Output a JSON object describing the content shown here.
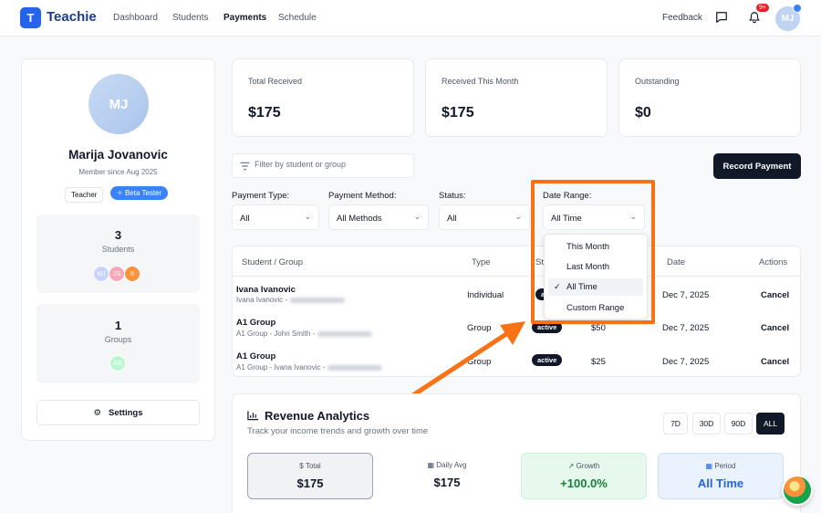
{
  "app": {
    "logo_letter": "T",
    "name": "Teachie"
  },
  "nav": {
    "links": [
      "Dashboard",
      "Students",
      "Payments",
      "Schedule"
    ],
    "active": "Payments",
    "feedback": "Feedback",
    "notif_badge": "9+",
    "user_initials": "MJ"
  },
  "profile": {
    "initials": "MJ",
    "name": "Marija Jovanovic",
    "member_since": "Member since Aug 2025",
    "tags": [
      "Teacher",
      "Beta Tester"
    ],
    "students_count": "3",
    "students_label": "Students",
    "student_avatars": [
      "MJ",
      "JS",
      "II"
    ],
    "groups_count": "1",
    "groups_label": "Groups",
    "group_avatars": [
      "AG"
    ],
    "settings_label": "Settings"
  },
  "metrics": [
    {
      "label": "Total Received",
      "value": "$175"
    },
    {
      "label": "Received This Month",
      "value": "$175"
    },
    {
      "label": "Outstanding",
      "value": "$0"
    }
  ],
  "filters": {
    "search_placeholder": "Filter by student or group",
    "record_button": "Record Payment",
    "payment_type": {
      "label": "Payment Type:",
      "value": "All"
    },
    "payment_method": {
      "label": "Payment Method:",
      "value": "All Methods"
    },
    "status": {
      "label": "Status:",
      "value": "All"
    },
    "date_range": {
      "label": "Date Range:",
      "value": "All Time",
      "options": [
        "This Month",
        "Last Month",
        "All Time",
        "Custom Range"
      ],
      "selected": "All Time"
    }
  },
  "table": {
    "headers": [
      "Student / Group",
      "Type",
      "St",
      "Date",
      "Actions"
    ],
    "rows": [
      {
        "name": "Ivana Ivanovic",
        "sub": "Ivana Ivanovic -",
        "type": "Individual",
        "status": "a",
        "amount": "",
        "date": "Dec 7, 2025",
        "action": "Cancel"
      },
      {
        "name": "A1 Group",
        "sub": "A1 Group - John Smith -",
        "type": "Group",
        "status": "active",
        "amount": "$50",
        "date": "Dec 7, 2025",
        "action": "Cancel"
      },
      {
        "name": "A1 Group",
        "sub": "A1 Group - Ivana Ivanovic -",
        "type": "Group",
        "status": "active",
        "amount": "$25",
        "date": "Dec 7, 2025",
        "action": "Cancel"
      }
    ]
  },
  "analytics": {
    "title": "Revenue Analytics",
    "subtitle": "Track your income trends and growth over time",
    "ranges": [
      "7D",
      "30D",
      "90D",
      "ALL"
    ],
    "active_range": "ALL",
    "cards": [
      {
        "label": "Total",
        "value": "$175"
      },
      {
        "label": "Daily Avg",
        "value": "$175"
      },
      {
        "label": "Growth",
        "value": "+100.0%"
      },
      {
        "label": "Period",
        "value": "All Time"
      }
    ]
  },
  "colors": {
    "accent": "#2563eb",
    "dark": "#111827",
    "highlight": "#f97316",
    "growth_bg": "#e7f8ec",
    "growth_fg": "#15803d",
    "period_bg": "#eaf2fd",
    "period_fg": "#2563eb"
  }
}
